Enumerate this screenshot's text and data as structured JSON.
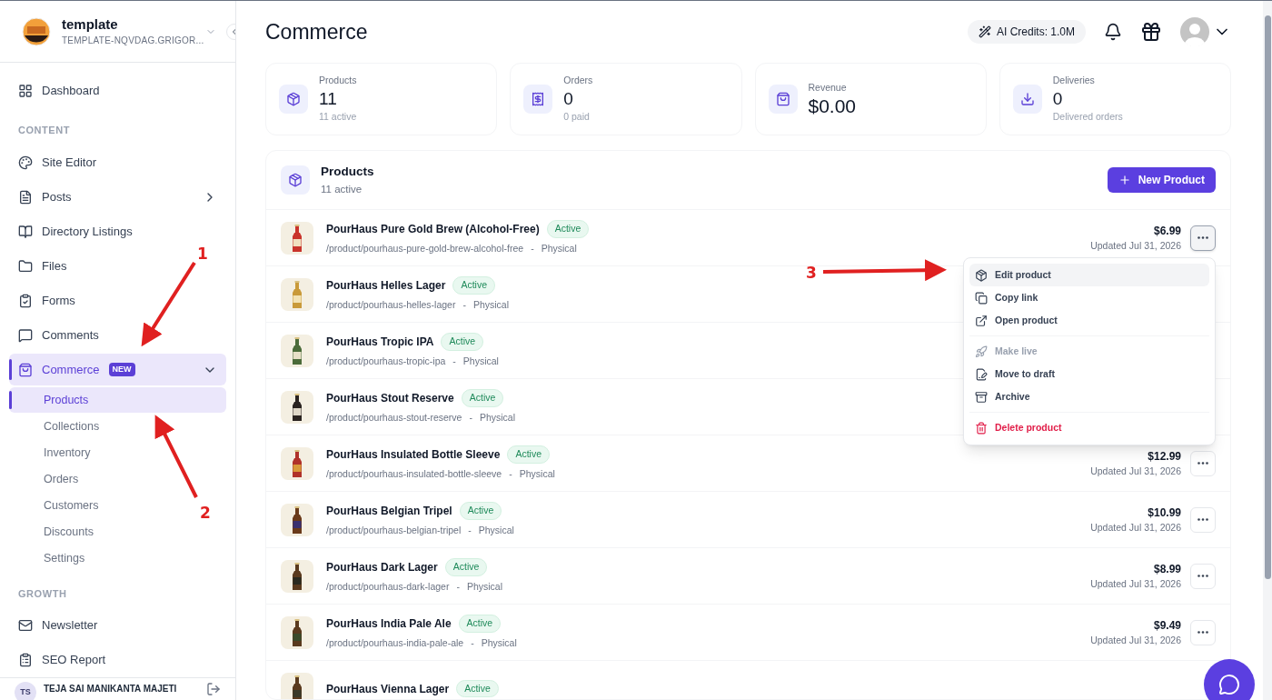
{
  "workspace": {
    "name": "template",
    "domain": "TEMPLATE-NQVDAG.GRIGOR..."
  },
  "sidebar": {
    "items": [
      {
        "label": "Dashboard",
        "selected": false
      },
      {
        "section": "CONTENT"
      },
      {
        "label": "Site Editor",
        "selected": false
      },
      {
        "label": "Posts",
        "selected": false,
        "expanded": false
      },
      {
        "label": "Directory Listings",
        "selected": false
      },
      {
        "label": "Files",
        "selected": false
      },
      {
        "label": "Forms",
        "selected": false
      },
      {
        "label": "Comments",
        "selected": false
      },
      {
        "label": "Commerce",
        "badge": "NEW",
        "selected": true,
        "expanded": true,
        "children": [
          {
            "label": "Products",
            "selected": true
          },
          {
            "label": "Collections",
            "selected": false
          },
          {
            "label": "Inventory",
            "selected": false
          },
          {
            "label": "Orders",
            "selected": false
          },
          {
            "label": "Customers",
            "selected": false
          },
          {
            "label": "Discounts",
            "selected": false
          },
          {
            "label": "Settings",
            "selected": false
          }
        ]
      },
      {
        "section": "GROWTH"
      },
      {
        "label": "Newsletter",
        "selected": false
      },
      {
        "label": "SEO Report",
        "selected": false
      }
    ],
    "user": {
      "initials": "TS",
      "name": "TEJA SAI MANIKANTA MAJETI"
    }
  },
  "page": {
    "title": "Commerce",
    "ai_credits": "AI Credits: 1.0M"
  },
  "stats": [
    {
      "label": "Products",
      "value": "11",
      "sub": "11 active"
    },
    {
      "label": "Orders",
      "value": "0",
      "sub": "0 paid"
    },
    {
      "label": "Revenue",
      "value": "$0.00"
    },
    {
      "label": "Deliveries",
      "value": "0",
      "sub": "Delivered orders"
    }
  ],
  "products": {
    "title": "Products",
    "subtitle": "11 active",
    "new_button": "New Product",
    "rows": [
      {
        "name": "PourHaus Pure Gold Brew (Alcohol-Free)",
        "status": "Active",
        "path": "/product/pourhaus-pure-gold-brew-alcohol-free",
        "separator": "-",
        "type": "Physical",
        "price": "$6.99",
        "updated": "Updated Jul 31, 2026",
        "menu_open": true
      },
      {
        "name": "PourHaus Helles Lager",
        "status": "Active",
        "path": "/product/pourhaus-helles-lager",
        "separator": "-",
        "type": "Physical"
      },
      {
        "name": "PourHaus Tropic IPA",
        "status": "Active",
        "path": "/product/pourhaus-tropic-ipa",
        "separator": "-",
        "type": "Physical"
      },
      {
        "name": "PourHaus Stout Reserve",
        "status": "Active",
        "path": "/product/pourhaus-stout-reserve",
        "separator": "-",
        "type": "Physical"
      },
      {
        "name": "PourHaus Insulated Bottle Sleeve",
        "status": "Active",
        "path": "/product/pourhaus-insulated-bottle-sleeve",
        "separator": "-",
        "type": "Physical",
        "price": "$12.99",
        "updated": "Updated Jul 31, 2026",
        "menu_open": false
      },
      {
        "name": "PourHaus Belgian Tripel",
        "status": "Active",
        "path": "/product/pourhaus-belgian-tripel",
        "separator": "-",
        "type": "Physical",
        "price": "$10.99",
        "updated": "Updated Jul 31, 2026",
        "menu_open": false
      },
      {
        "name": "PourHaus Dark Lager",
        "status": "Active",
        "path": "/product/pourhaus-dark-lager",
        "separator": "-",
        "type": "Physical",
        "price": "$8.99",
        "updated": "Updated Jul 31, 2026",
        "menu_open": false
      },
      {
        "name": "PourHaus India Pale Ale",
        "status": "Active",
        "path": "/product/pourhaus-india-pale-ale",
        "separator": "-",
        "type": "Physical",
        "price": "$9.49",
        "updated": "Updated Jul 31, 2026",
        "menu_open": false
      },
      {
        "name": "PourHaus Vienna Lager",
        "status": "Active"
      }
    ]
  },
  "menu": {
    "items": [
      {
        "label": "Edit product",
        "kind": "normal",
        "selected": true,
        "disabled": false
      },
      {
        "label": "Copy link",
        "kind": "normal",
        "selected": false,
        "disabled": false
      },
      {
        "label": "Open product",
        "kind": "normal",
        "selected": false,
        "disabled": false
      },
      {
        "kind": "divider"
      },
      {
        "label": "Make live",
        "kind": "normal",
        "selected": false,
        "disabled": true
      },
      {
        "label": "Move to draft",
        "kind": "normal",
        "selected": false,
        "disabled": false
      },
      {
        "label": "Archive",
        "kind": "normal",
        "selected": false,
        "disabled": false
      },
      {
        "kind": "divider"
      },
      {
        "label": "Delete product",
        "kind": "danger",
        "selected": false,
        "disabled": false
      }
    ]
  },
  "annotations": [
    "1",
    "2",
    "3"
  ]
}
